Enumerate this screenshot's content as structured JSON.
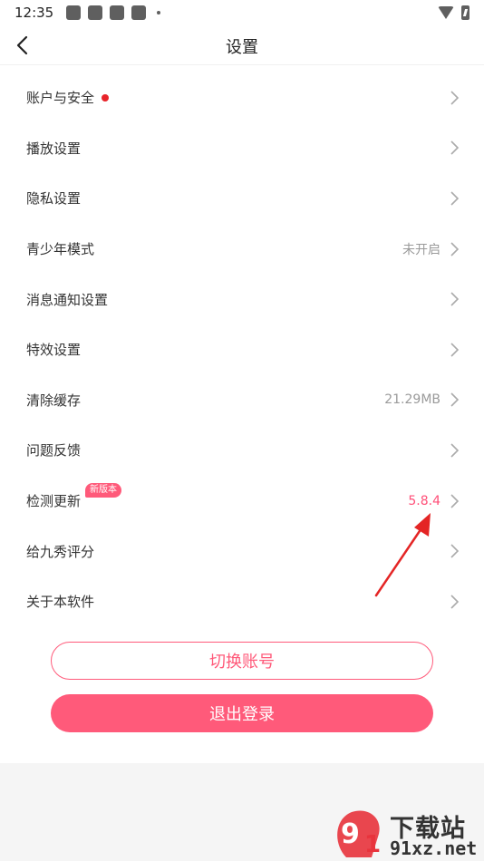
{
  "status_bar": {
    "time": "12:35"
  },
  "header": {
    "title": "设置"
  },
  "settings": [
    {
      "label": "账户与安全",
      "value": "",
      "has_dot": true
    },
    {
      "label": "播放设置",
      "value": ""
    },
    {
      "label": "隐私设置",
      "value": ""
    },
    {
      "label": "青少年模式",
      "value": "未开启"
    },
    {
      "label": "消息通知设置",
      "value": ""
    },
    {
      "label": "特效设置",
      "value": ""
    },
    {
      "label": "清除缓存",
      "value": "21.29MB"
    },
    {
      "label": "问题反馈",
      "value": ""
    },
    {
      "label": "检测更新",
      "value": "5.8.4",
      "badge": "新版本"
    },
    {
      "label": "给九秀评分",
      "value": ""
    },
    {
      "label": "关于本软件",
      "value": ""
    }
  ],
  "buttons": {
    "switch_account": "切换账号",
    "logout": "退出登录"
  },
  "watermark": {
    "line1": "下载站",
    "line2": "91xz.net"
  },
  "colors": {
    "accent": "#ff5a7a",
    "dot": "#e8242a",
    "value_gray": "#9a9a9a"
  }
}
